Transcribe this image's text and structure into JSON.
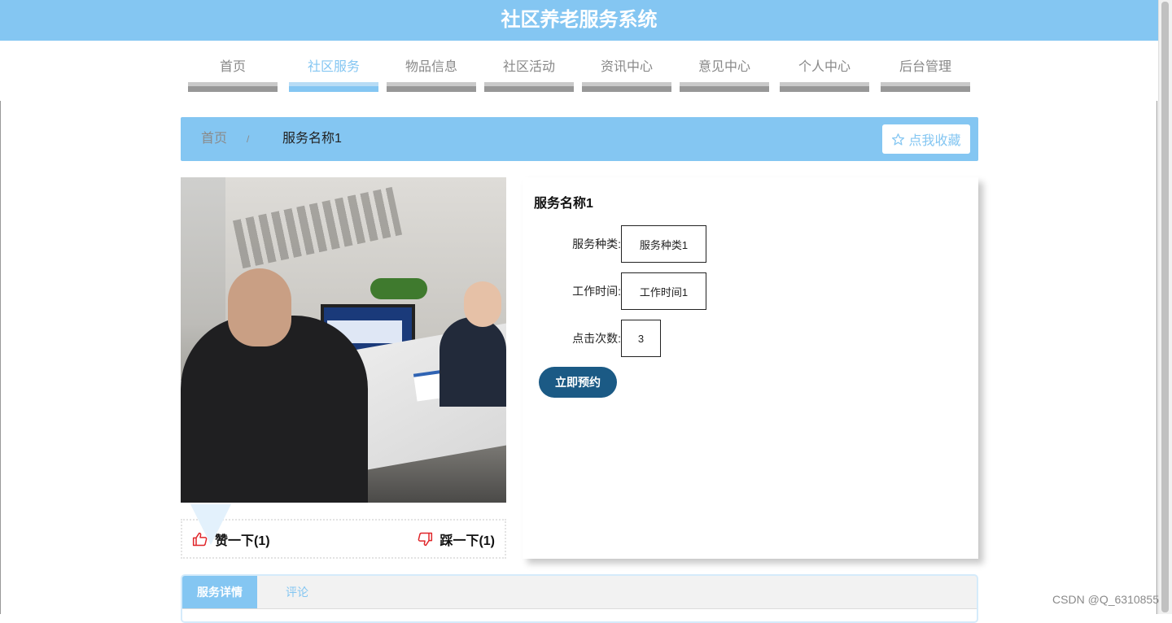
{
  "header": {
    "title": "社区养老服务系统"
  },
  "nav": {
    "items": [
      {
        "label": "首页",
        "active": false
      },
      {
        "label": "社区服务",
        "active": true
      },
      {
        "label": "物品信息",
        "active": false
      },
      {
        "label": "社区活动",
        "active": false
      },
      {
        "label": "资讯中心",
        "active": false
      },
      {
        "label": "意见中心",
        "active": false
      },
      {
        "label": "个人中心",
        "active": false
      },
      {
        "label": "后台管理",
        "active": false
      }
    ]
  },
  "breadcrumb": {
    "home": "首页",
    "separator": "/",
    "current": "服务名称1"
  },
  "favorite": {
    "label": "点我收藏",
    "icon": "star-outline-icon"
  },
  "vote": {
    "like_label": "赞一下(1)",
    "like_icon": "thumbs-up-icon",
    "dislike_label": "踩一下(1)",
    "dislike_icon": "thumbs-down-icon"
  },
  "detail": {
    "title": "服务名称1",
    "fields": [
      {
        "key": "服务种类:",
        "value": "服务种类1"
      },
      {
        "key": "工作时间:",
        "value": "工作时间1"
      },
      {
        "key": "点击次数:",
        "value": "3"
      }
    ],
    "book_label": "立即预约"
  },
  "tabs": {
    "items": [
      {
        "label": "服务详情",
        "active": true
      },
      {
        "label": "评论",
        "active": false
      }
    ]
  },
  "watermark": "CSDN @Q_6310855",
  "colors": {
    "primary": "#84c6f2",
    "button_dark": "#1b5a85",
    "like_red": "#e0262a"
  }
}
